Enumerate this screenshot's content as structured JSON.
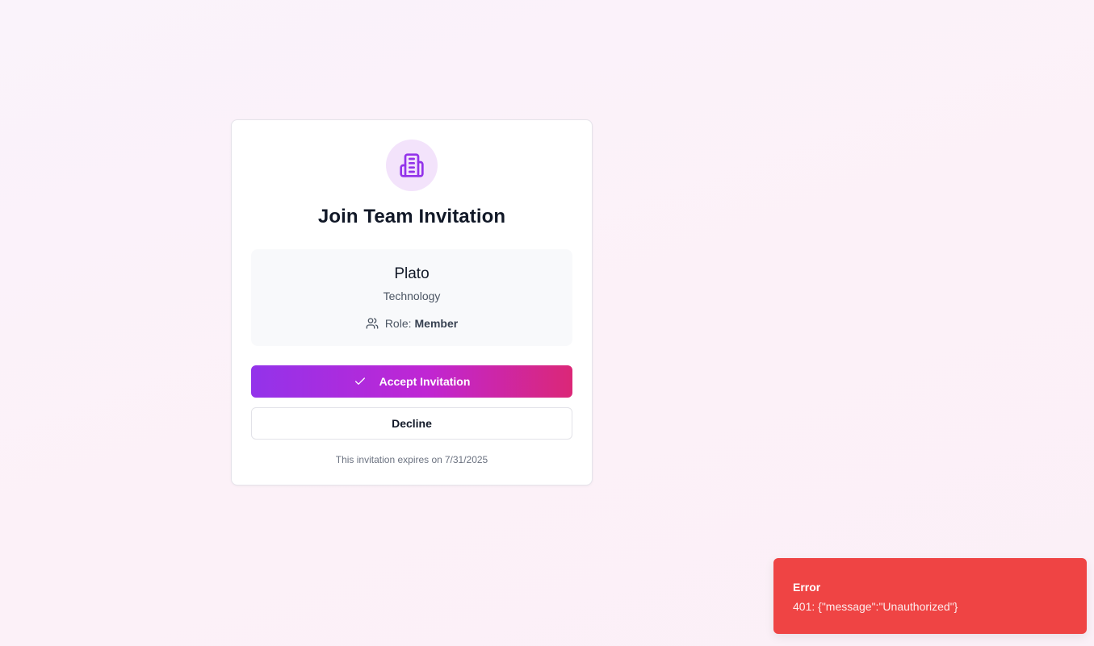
{
  "colors": {
    "accent_purple": "#9333ea",
    "accent_pink": "#db2777",
    "icon_bg": "#f3e3fb",
    "error_red": "#ef4444"
  },
  "invitation": {
    "icon": "building-icon",
    "title": "Join Team Invitation",
    "team": {
      "name": "Plato",
      "industry": "Technology",
      "role_icon": "users-icon",
      "role_label": "Role:",
      "role_value": "Member"
    },
    "accept_label": "Accept Invitation",
    "accept_icon": "check-icon",
    "decline_label": "Decline",
    "expiry_text": "This invitation expires on",
    "expiry_date": "7/31/2025"
  },
  "toast": {
    "title": "Error",
    "message": "401: {\"message\":\"Unauthorized\"}"
  }
}
